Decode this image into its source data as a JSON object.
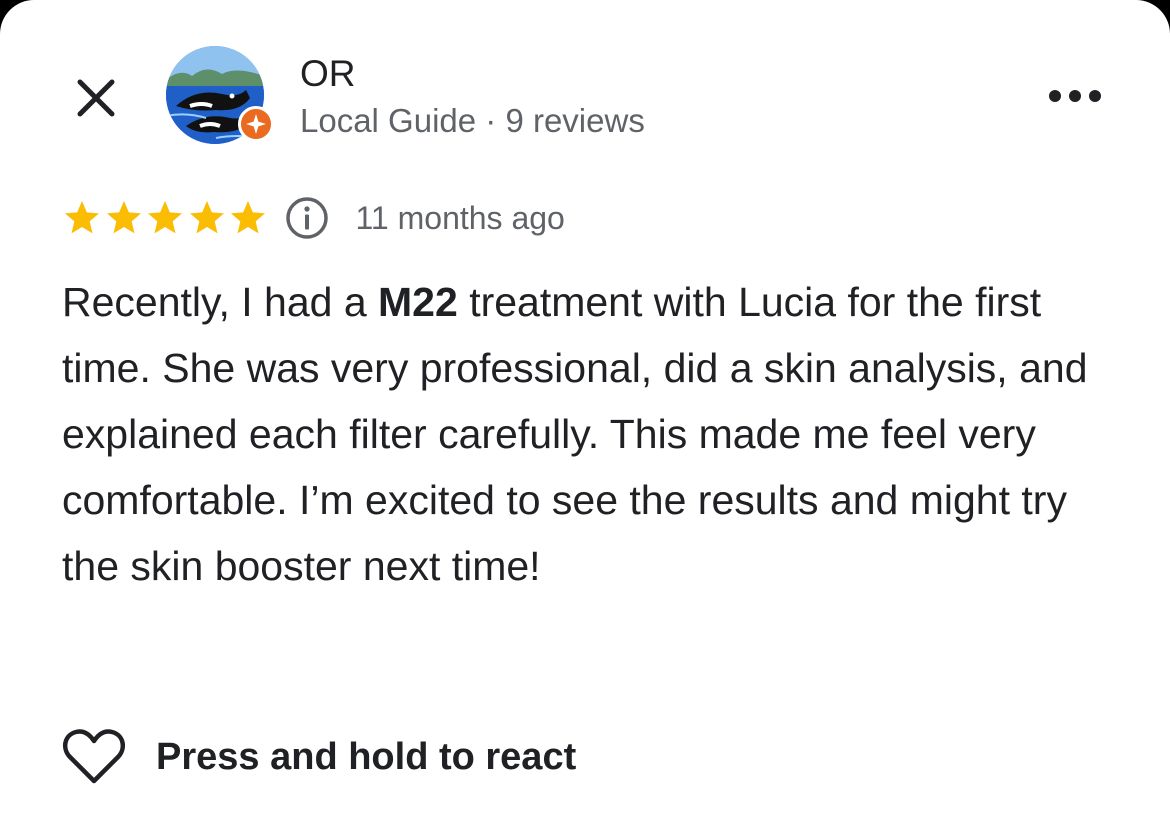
{
  "reviewer": {
    "name": "OR",
    "meta": "Local Guide · 9 reviews",
    "avatar_icon": "orca-whale-avatar",
    "badge_icon": "local-guide-star-badge"
  },
  "review": {
    "rating": 5,
    "rating_max": 5,
    "star_color": "#fbbc04",
    "date": "11 months ago",
    "text_before": "Recently, I had a ",
    "text_bold": "M22",
    "text_after": " treatment with Lucia for the first time. She was very professional, did a skin analysis, and explained each filter carefully. This made me feel very comfortable. I’m excited to see the results and might try the skin booster next time!"
  },
  "actions": {
    "react_label": "Press and hold to react",
    "close_icon": "close-icon",
    "more_icon": "more-horizontal-icon",
    "info_icon": "info-icon",
    "heart_icon": "heart-outline-icon"
  },
  "colors": {
    "badge": "#ea6a1f",
    "text_primary": "#202124",
    "text_secondary": "#5f6368"
  }
}
